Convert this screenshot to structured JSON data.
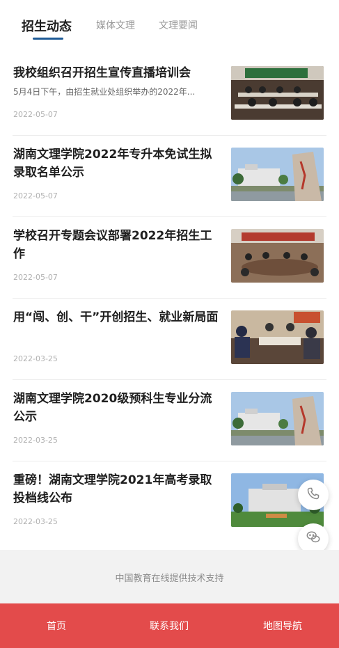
{
  "tabs": [
    {
      "label": "招生动态",
      "active": true
    },
    {
      "label": "媒体文理",
      "active": false
    },
    {
      "label": "文理要闻",
      "active": false
    }
  ],
  "news": [
    {
      "title": "我校组织召开招生宣传直播培训会",
      "summary": "5月4日下午，由招生就业处组织举办的2022年...",
      "date": "2022-05-07",
      "image": "meeting-room-photo"
    },
    {
      "title": "湖南文理学院2022年专升本免试生拟录取名单公示",
      "summary": "",
      "date": "2022-05-07",
      "image": "campus-stone-photo"
    },
    {
      "title": "学校召开专题会议部署2022年招生工作",
      "summary": "",
      "date": "2022-05-07",
      "image": "conference-table-photo"
    },
    {
      "title": "用“闯、创、干”开创招生、就业新局面",
      "summary": "",
      "date": "2022-03-25",
      "image": "discussion-photo"
    },
    {
      "title": "湖南文理学院2020级预科生专业分流公示",
      "summary": "",
      "date": "2022-03-25",
      "image": "campus-stone-photo"
    },
    {
      "title": "重磅！湖南文理学院2021年高考录取投档线公布",
      "summary": "",
      "date": "2022-03-25",
      "image": "campus-building-photo"
    }
  ],
  "floating": {
    "phone_icon": "phone-icon",
    "wechat_icon": "wechat-icon"
  },
  "footer": {
    "text": "中国教育在线提供技术支持"
  },
  "bottom_nav": [
    {
      "label": "首页"
    },
    {
      "label": "联系我们"
    },
    {
      "label": "地图导航"
    }
  ],
  "colors": {
    "accent": "#1e5a96",
    "bottom_bar": "#e34b4b"
  }
}
